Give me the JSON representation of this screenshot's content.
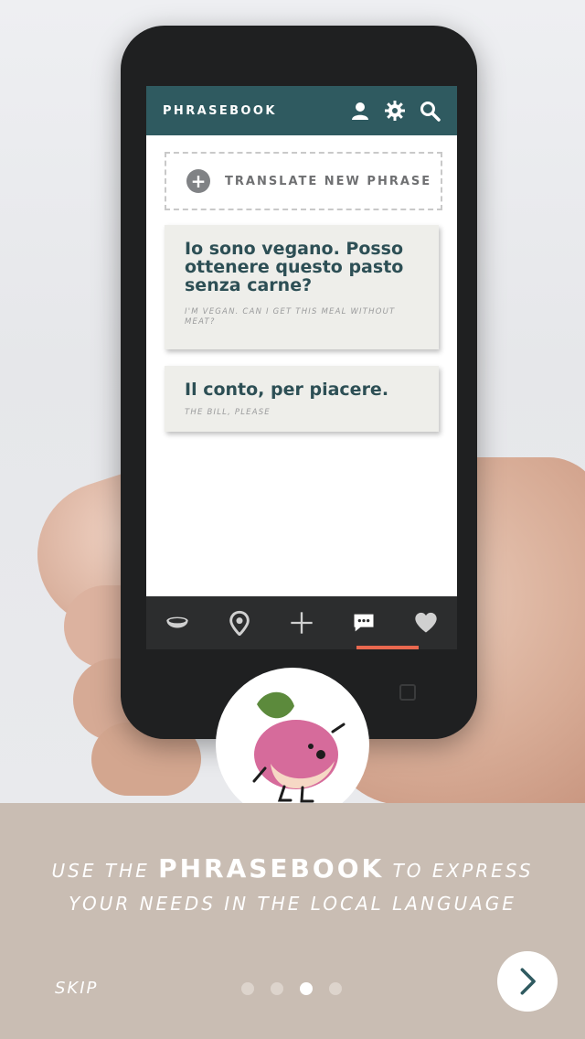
{
  "appbar": {
    "title": "PHRASEBOOK"
  },
  "translate": {
    "label": "TRANSLATE NEW PHRASE"
  },
  "cards": [
    {
      "phrase": "Io sono vegano. Posso ottenere questo pasto senza carne?",
      "translation": "I'M VEGAN. CAN I GET THIS MEAL WITHOUT MEAT?"
    },
    {
      "phrase": "Il conto, per piacere.",
      "translation": "THE BILL, PLEASE"
    }
  ],
  "tabs": [
    "bowl-icon",
    "location-pin-icon",
    "plus-icon",
    "chat-icon",
    "heart-icon"
  ],
  "onboarding": {
    "line1_pre": "USE THE",
    "line1_bold": "PHRASEBOOK",
    "line1_post": "TO EXPRESS",
    "line2": "YOUR NEEDS IN THE LOCAL LANGUAGE",
    "skip": "SKIP",
    "page_index": 3,
    "page_count": 4
  },
  "colors": {
    "appbar": "#2f5a60",
    "accent": "#e9684f",
    "panel": "#c9bdb3"
  }
}
